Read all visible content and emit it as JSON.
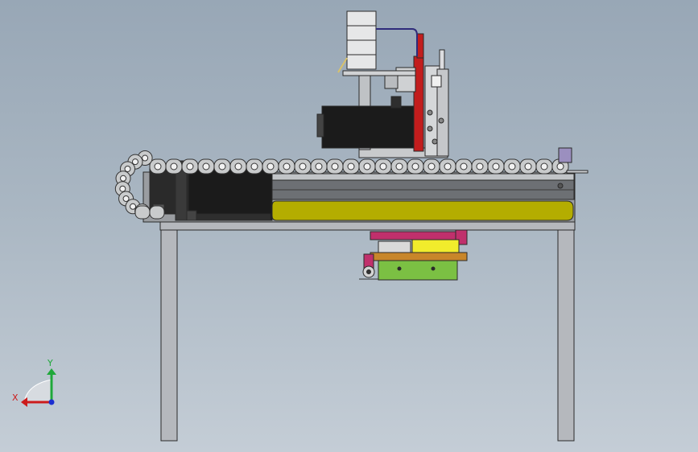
{
  "viewport": {
    "background_top": "#98a7b6",
    "background_bottom": "#c4cdd6"
  },
  "triad": {
    "x_label": "X",
    "y_label": "Y",
    "x_color": "#cc1b1b",
    "y_color": "#1fa83a",
    "z_color": "#1c2fd1"
  },
  "colors": {
    "frame": "#b5b8bd",
    "frame_edge": "#2a2a2a",
    "chain_link": "#c9cbcc",
    "motor_body": "#1b1b1b",
    "rail_yellow": "#b4ad00",
    "red_bracket": "#c21d1d",
    "magenta_part": "#c0306c",
    "bronze_part": "#c8862a",
    "green_block": "#7bc043",
    "cylinder_yellow": "#f1ec2c",
    "purple_cap": "#9b8fbf"
  },
  "icons": {
    "triad": "axis-triad-icon"
  }
}
